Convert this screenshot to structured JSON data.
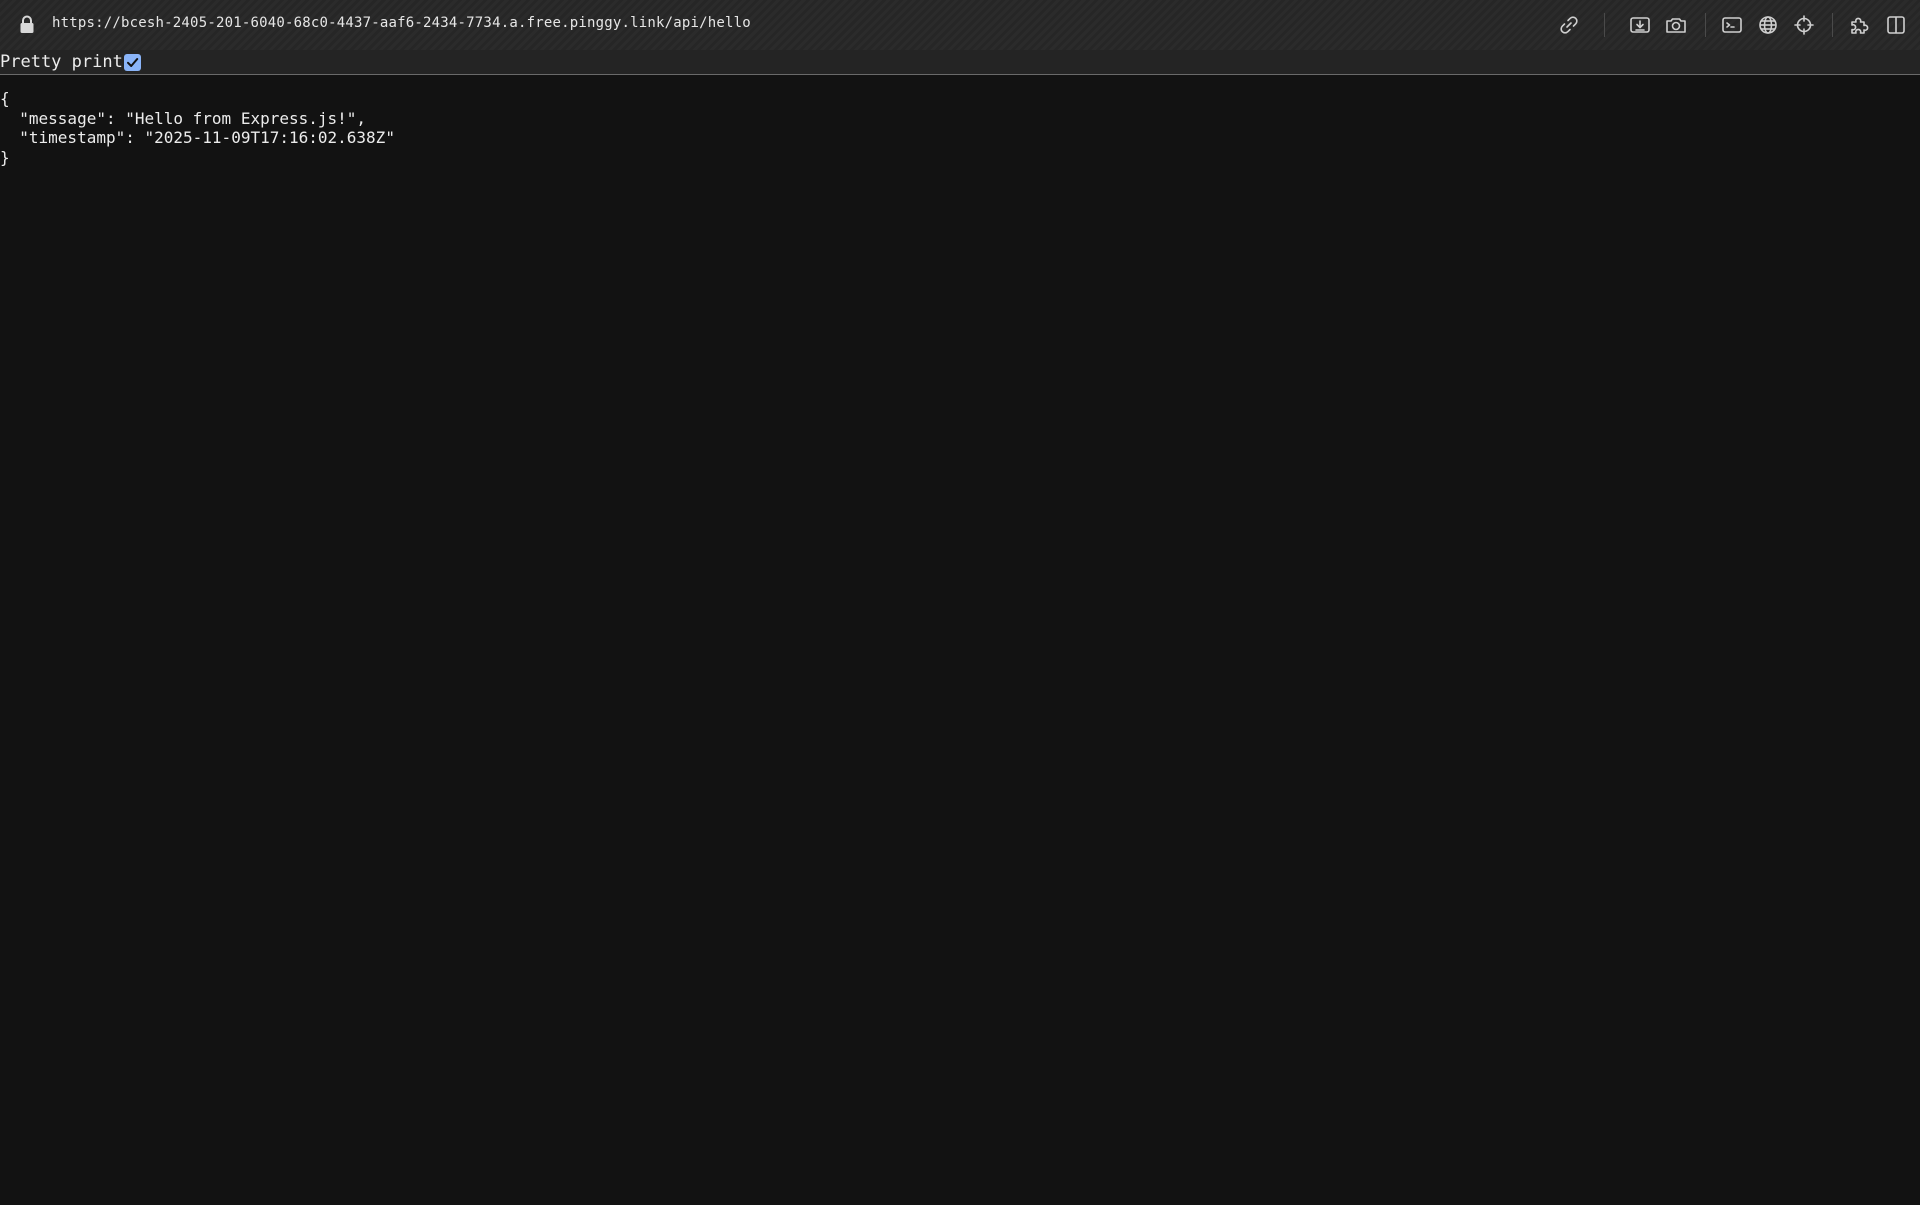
{
  "address_bar": {
    "url": "https://bcesh-2405-201-6040-68c0-4437-aaf6-2434-7734.a.free.pinggy.link/api/hello"
  },
  "toolbar_icons": [
    {
      "name": "link-icon"
    },
    {
      "name": "download-page-icon"
    },
    {
      "name": "camera-icon"
    },
    {
      "name": "terminal-icon"
    },
    {
      "name": "globe-icon"
    },
    {
      "name": "crosshair-icon"
    },
    {
      "name": "extensions-icon"
    },
    {
      "name": "split-view-icon"
    }
  ],
  "json_viewer": {
    "pretty_print_label": "Pretty print",
    "pretty_print_checked": true,
    "lines": {
      "open": "{",
      "message": "  \"message\": \"Hello from Express.js!\",",
      "timestamp": "  \"timestamp\": \"2025-11-09T17:16:02.638Z\"",
      "close": "}"
    }
  },
  "colors": {
    "page_background": "#121212",
    "text": "#ececec",
    "checkbox_accent": "#8ab4f8"
  }
}
